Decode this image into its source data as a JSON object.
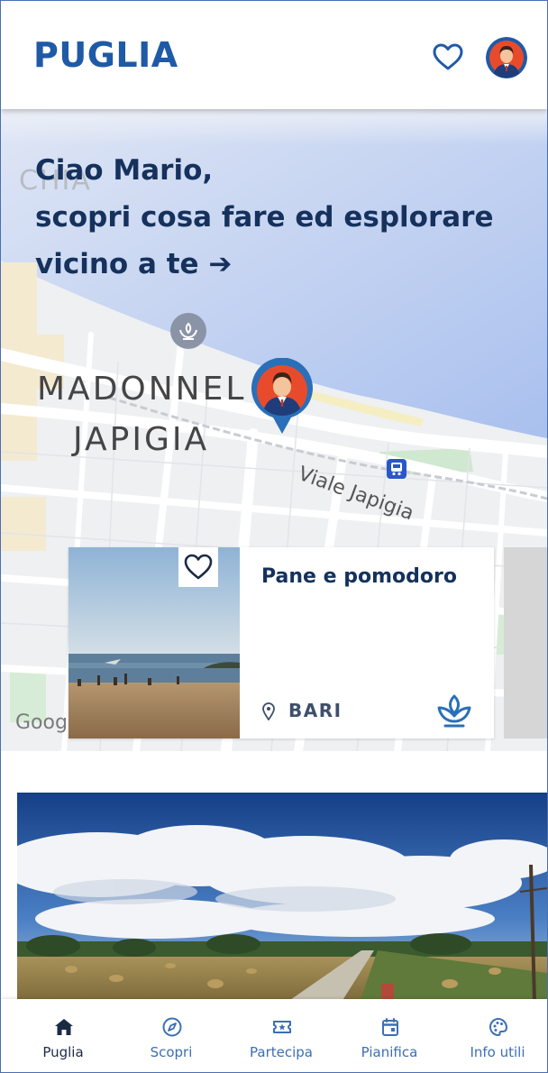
{
  "header": {
    "brand": "PUGLIA",
    "icons": [
      "heart-outline-icon",
      "user-avatar"
    ]
  },
  "hero": {
    "greeting_line1": "Ciao Mario,",
    "greeting_line2": "scopri cosa fare ed esplorare",
    "greeting_line3": "vicino a te ➔"
  },
  "map": {
    "labels": {
      "district_top": "MADONNEL",
      "district_bottom": "JAPIGIA",
      "street": "Viale Japigia",
      "partial_top": "CHIA",
      "attribution": "Goog"
    },
    "markers": [
      "sprout-poi-pin",
      "user-location-pin",
      "bus-stop-icon"
    ]
  },
  "card": {
    "title": "Pane e pomodoro",
    "city": "BARI",
    "icons": [
      "heart-outline-icon",
      "location-pin-icon",
      "sprout-icon"
    ]
  },
  "bottom_nav": {
    "items": [
      {
        "label": "Puglia",
        "icon": "home-icon",
        "active": true
      },
      {
        "label": "Scopri",
        "icon": "compass-icon",
        "active": false
      },
      {
        "label": "Partecipa",
        "icon": "ticket-star-icon",
        "active": false
      },
      {
        "label": "Pianifica",
        "icon": "calendar-icon",
        "active": false
      },
      {
        "label": "Info utili",
        "icon": "info-palette-icon",
        "active": false
      }
    ]
  },
  "colors": {
    "brand_blue": "#1f5aa6",
    "heading_navy": "#15315c",
    "nav_blue": "#3b6fb6",
    "sea_blue": "#b9ccef"
  }
}
